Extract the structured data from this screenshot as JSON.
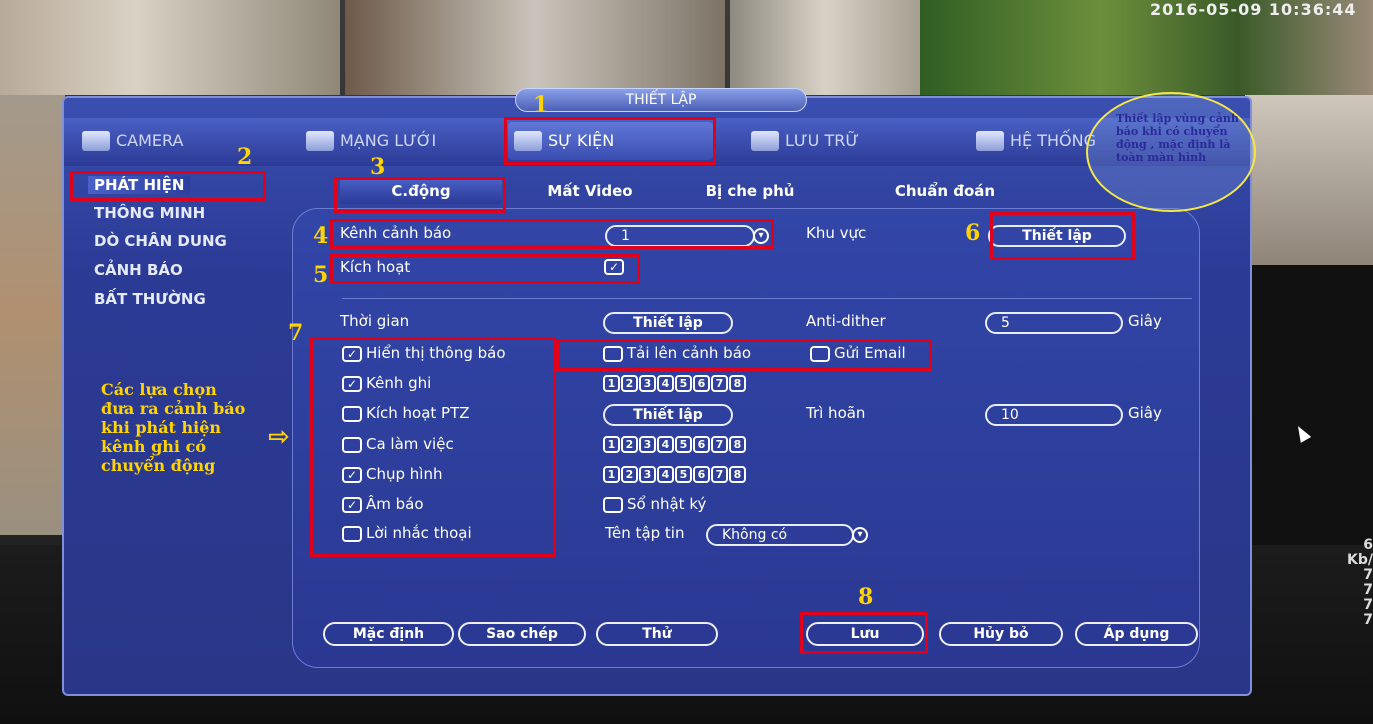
{
  "overlay": {
    "clock": "2016-05-09 10:36:44",
    "kb_label": "Kb/",
    "kb_values": [
      "6",
      "7",
      "7",
      "7",
      "7"
    ]
  },
  "window": {
    "title": "THIẾT LẬP"
  },
  "tabs": [
    {
      "label": "CAMERA"
    },
    {
      "label": "MẠNG LƯỚI"
    },
    {
      "label": "SỰ KIỆN"
    },
    {
      "label": "LƯU TRỮ"
    },
    {
      "label": "HỆ THỐNG"
    }
  ],
  "sidebar": {
    "items": [
      {
        "label": "PHÁT HIỆN"
      },
      {
        "label": "THÔNG MINH"
      },
      {
        "label": "DÒ CHÂN DUNG"
      },
      {
        "label": "CẢNH BÁO"
      },
      {
        "label": "BẤT THƯỜNG"
      }
    ]
  },
  "subtabs": [
    {
      "label": "C.động"
    },
    {
      "label": "Mất Video"
    },
    {
      "label": "Bị che phủ"
    },
    {
      "label": "Chuẩn đoán"
    }
  ],
  "form": {
    "alarm_channel_label": "Kênh cảnh báo",
    "alarm_channel_value": "1",
    "area_label": "Khu vực",
    "area_button": "Thiết lập",
    "enable_label": "Kích hoạt",
    "period_label": "Thời gian",
    "period_button": "Thiết lập",
    "anti_dither_label": "Anti-dither",
    "anti_dither_value": "5",
    "anti_dither_unit": "Giây",
    "show_message": "Hiển thị thông báo",
    "upload_alarm": "Tải lên cảnh báo",
    "send_email": "Gửi Email",
    "record_channel": "Kênh ghi",
    "ptz_activation": "Kích hoạt PTZ",
    "ptz_button": "Thiết lập",
    "delay_label": "Trì hoãn",
    "delay_value": "10",
    "delay_unit": "Giây",
    "tour": "Ca làm việc",
    "snapshot": "Chụp hình",
    "buzzer": "Âm báo",
    "log": "Sổ nhật ký",
    "voice_prompt": "Lời nhắc thoại",
    "file_name_label": "Tên tập tin",
    "file_name_value": "Không có",
    "channels": [
      "1",
      "2",
      "3",
      "4",
      "5",
      "6",
      "7",
      "8"
    ]
  },
  "buttons": {
    "default": "Mặc định",
    "copy": "Sao chép",
    "test": "Thử",
    "save": "Lưu",
    "cancel": "Hủy bỏ",
    "apply": "Áp dụng"
  },
  "annotations": {
    "n1": "1",
    "n2": "2",
    "n3": "3",
    "n4": "4",
    "n5": "5",
    "n6": "6",
    "n7": "7",
    "n8": "8",
    "bubble": [
      "Thiết lập vùng cảnh",
      "báo khi có chuyển",
      "động , mặc định là",
      "toàn màn hình"
    ],
    "left_note": [
      "Các lựa chọn",
      "đưa ra cảnh báo",
      "khi phát hiện",
      "kênh ghi có",
      "chuyển động"
    ],
    "arrow": "⇨"
  }
}
